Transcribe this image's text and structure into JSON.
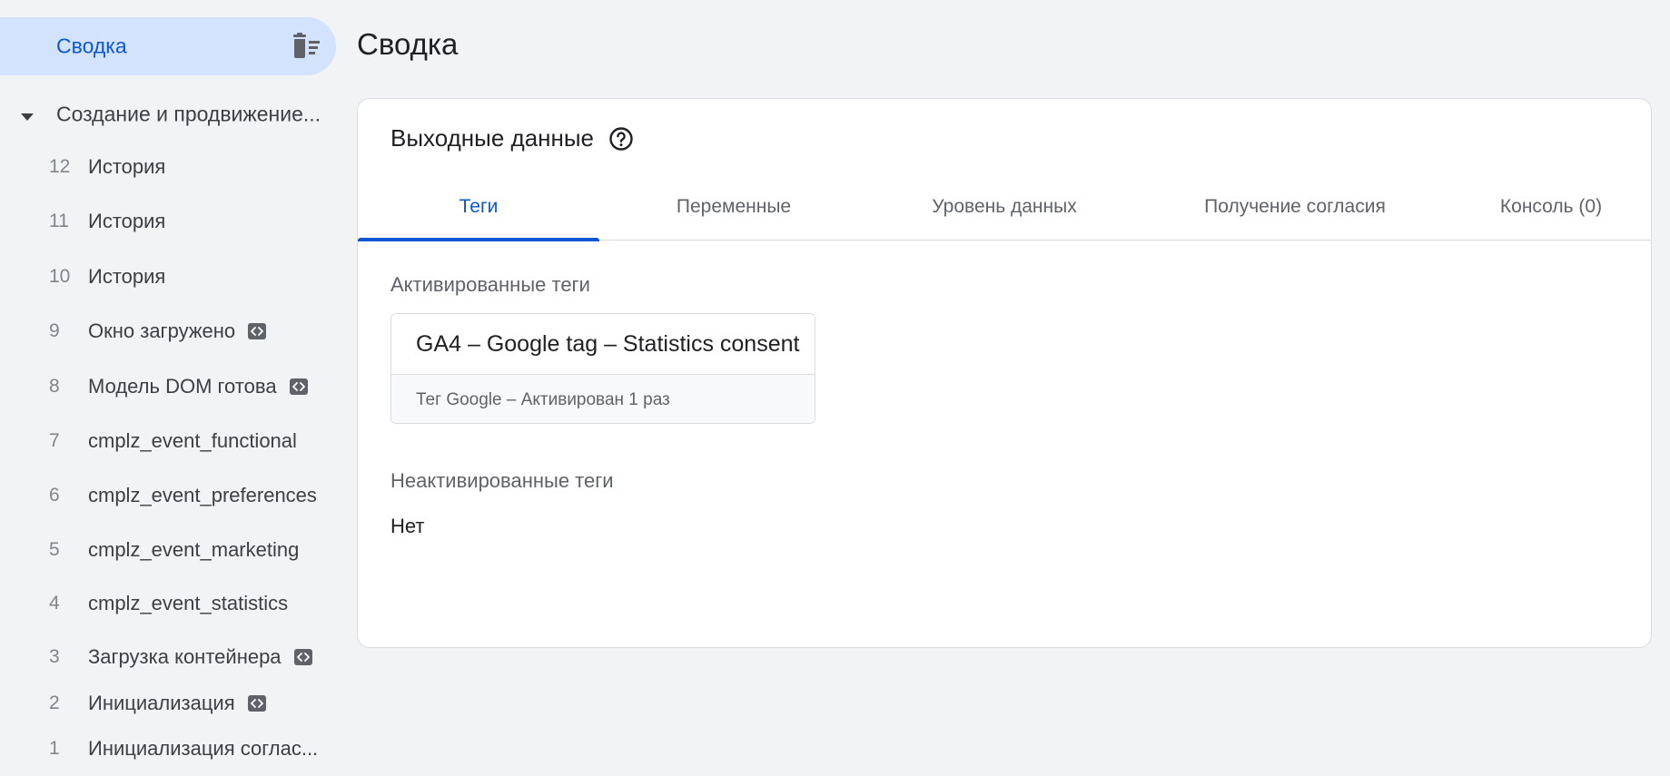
{
  "sidebar": {
    "summary_label": "Сводка",
    "container_label": "Создание и продвижение...",
    "events": [
      {
        "num": "12",
        "name": "История",
        "badge": false
      },
      {
        "num": "11",
        "name": "История",
        "badge": false
      },
      {
        "num": "10",
        "name": "История",
        "badge": false
      },
      {
        "num": "9",
        "name": "Окно загружено",
        "badge": true
      },
      {
        "num": "8",
        "name": "Модель DOM готова",
        "badge": true
      },
      {
        "num": "7",
        "name": "cmplz_event_functional",
        "badge": false
      },
      {
        "num": "6",
        "name": "cmplz_event_preferences",
        "badge": false
      },
      {
        "num": "5",
        "name": "cmplz_event_marketing",
        "badge": false
      },
      {
        "num": "4",
        "name": "cmplz_event_statistics",
        "badge": false
      },
      {
        "num": "3",
        "name": "Загрузка контейнера",
        "badge": true
      },
      {
        "num": "2",
        "name": "Инициализация",
        "badge": true
      },
      {
        "num": "1",
        "name": "Инициализация соглас...",
        "badge": false
      }
    ]
  },
  "main": {
    "page_title": "Сводка",
    "card_title": "Выходные данные",
    "tabs": [
      {
        "label": "Теги",
        "active": true
      },
      {
        "label": "Переменные",
        "active": false
      },
      {
        "label": "Уровень данных",
        "active": false
      },
      {
        "label": "Получение согласия",
        "active": false
      },
      {
        "label": "Консоль (0)",
        "active": false
      }
    ],
    "fired_label": "Активированные теги",
    "fired_tag": {
      "name": "GA4 – Google tag – Statistics consent",
      "meta": "Тег Google – Активирован 1 раз"
    },
    "not_fired_label": "Неактивированные теги",
    "not_fired_value": "Нет"
  },
  "colors": {
    "accent": "#0b57d0",
    "selected_bg": "#d3e3fd",
    "page_bg": "#f1f3f4"
  },
  "icons": {
    "clear": "clear-all-icon",
    "caret": "caret-down-icon",
    "help": "help-circle-icon",
    "badge": "code-icon"
  }
}
